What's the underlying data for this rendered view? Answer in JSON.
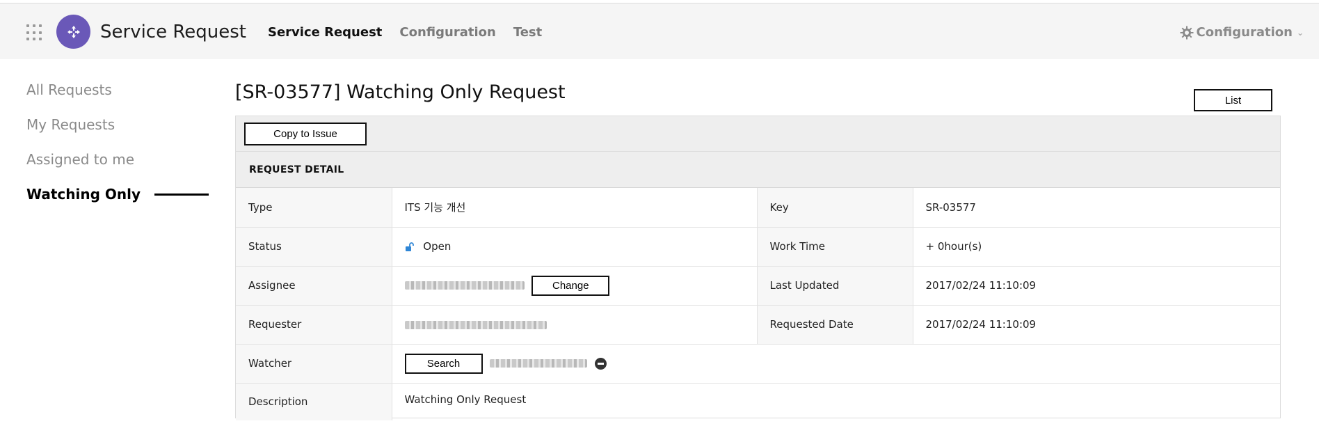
{
  "header": {
    "app_title": "Service Request",
    "nav": [
      {
        "label": "Service Request",
        "active": true
      },
      {
        "label": "Configuration",
        "active": false
      },
      {
        "label": "Test",
        "active": false
      }
    ],
    "config_menu_label": "Configuration",
    "accent_color": "#6a58b8"
  },
  "sidebar": {
    "items": [
      {
        "label": "All Requests",
        "active": false
      },
      {
        "label": "My Requests",
        "active": false
      },
      {
        "label": "Assigned to me",
        "active": false
      },
      {
        "label": "Watching Only",
        "active": true
      }
    ]
  },
  "page": {
    "title": "[SR-03577] Watching Only Request",
    "list_button": "List",
    "copy_button": "Copy to Issue",
    "section_title": "REQUEST DETAIL"
  },
  "detail": {
    "type_label": "Type",
    "type_value": "ITS 기능 개선",
    "key_label": "Key",
    "key_value": "SR-03577",
    "status_label": "Status",
    "status_value": "Open",
    "status_icon": "unlock-icon",
    "worktime_label": "Work Time",
    "worktime_value": "+ 0hour(s)",
    "assignee_label": "Assignee",
    "change_button": "Change",
    "updated_label": "Last Updated",
    "updated_value": "2017/02/24 11:10:09",
    "requester_label": "Requester",
    "requested_label": "Requested Date",
    "requested_value": "2017/02/24 11:10:09",
    "watcher_label": "Watcher",
    "search_button": "Search",
    "description_label": "Description",
    "description_value": "Watching Only Request"
  }
}
